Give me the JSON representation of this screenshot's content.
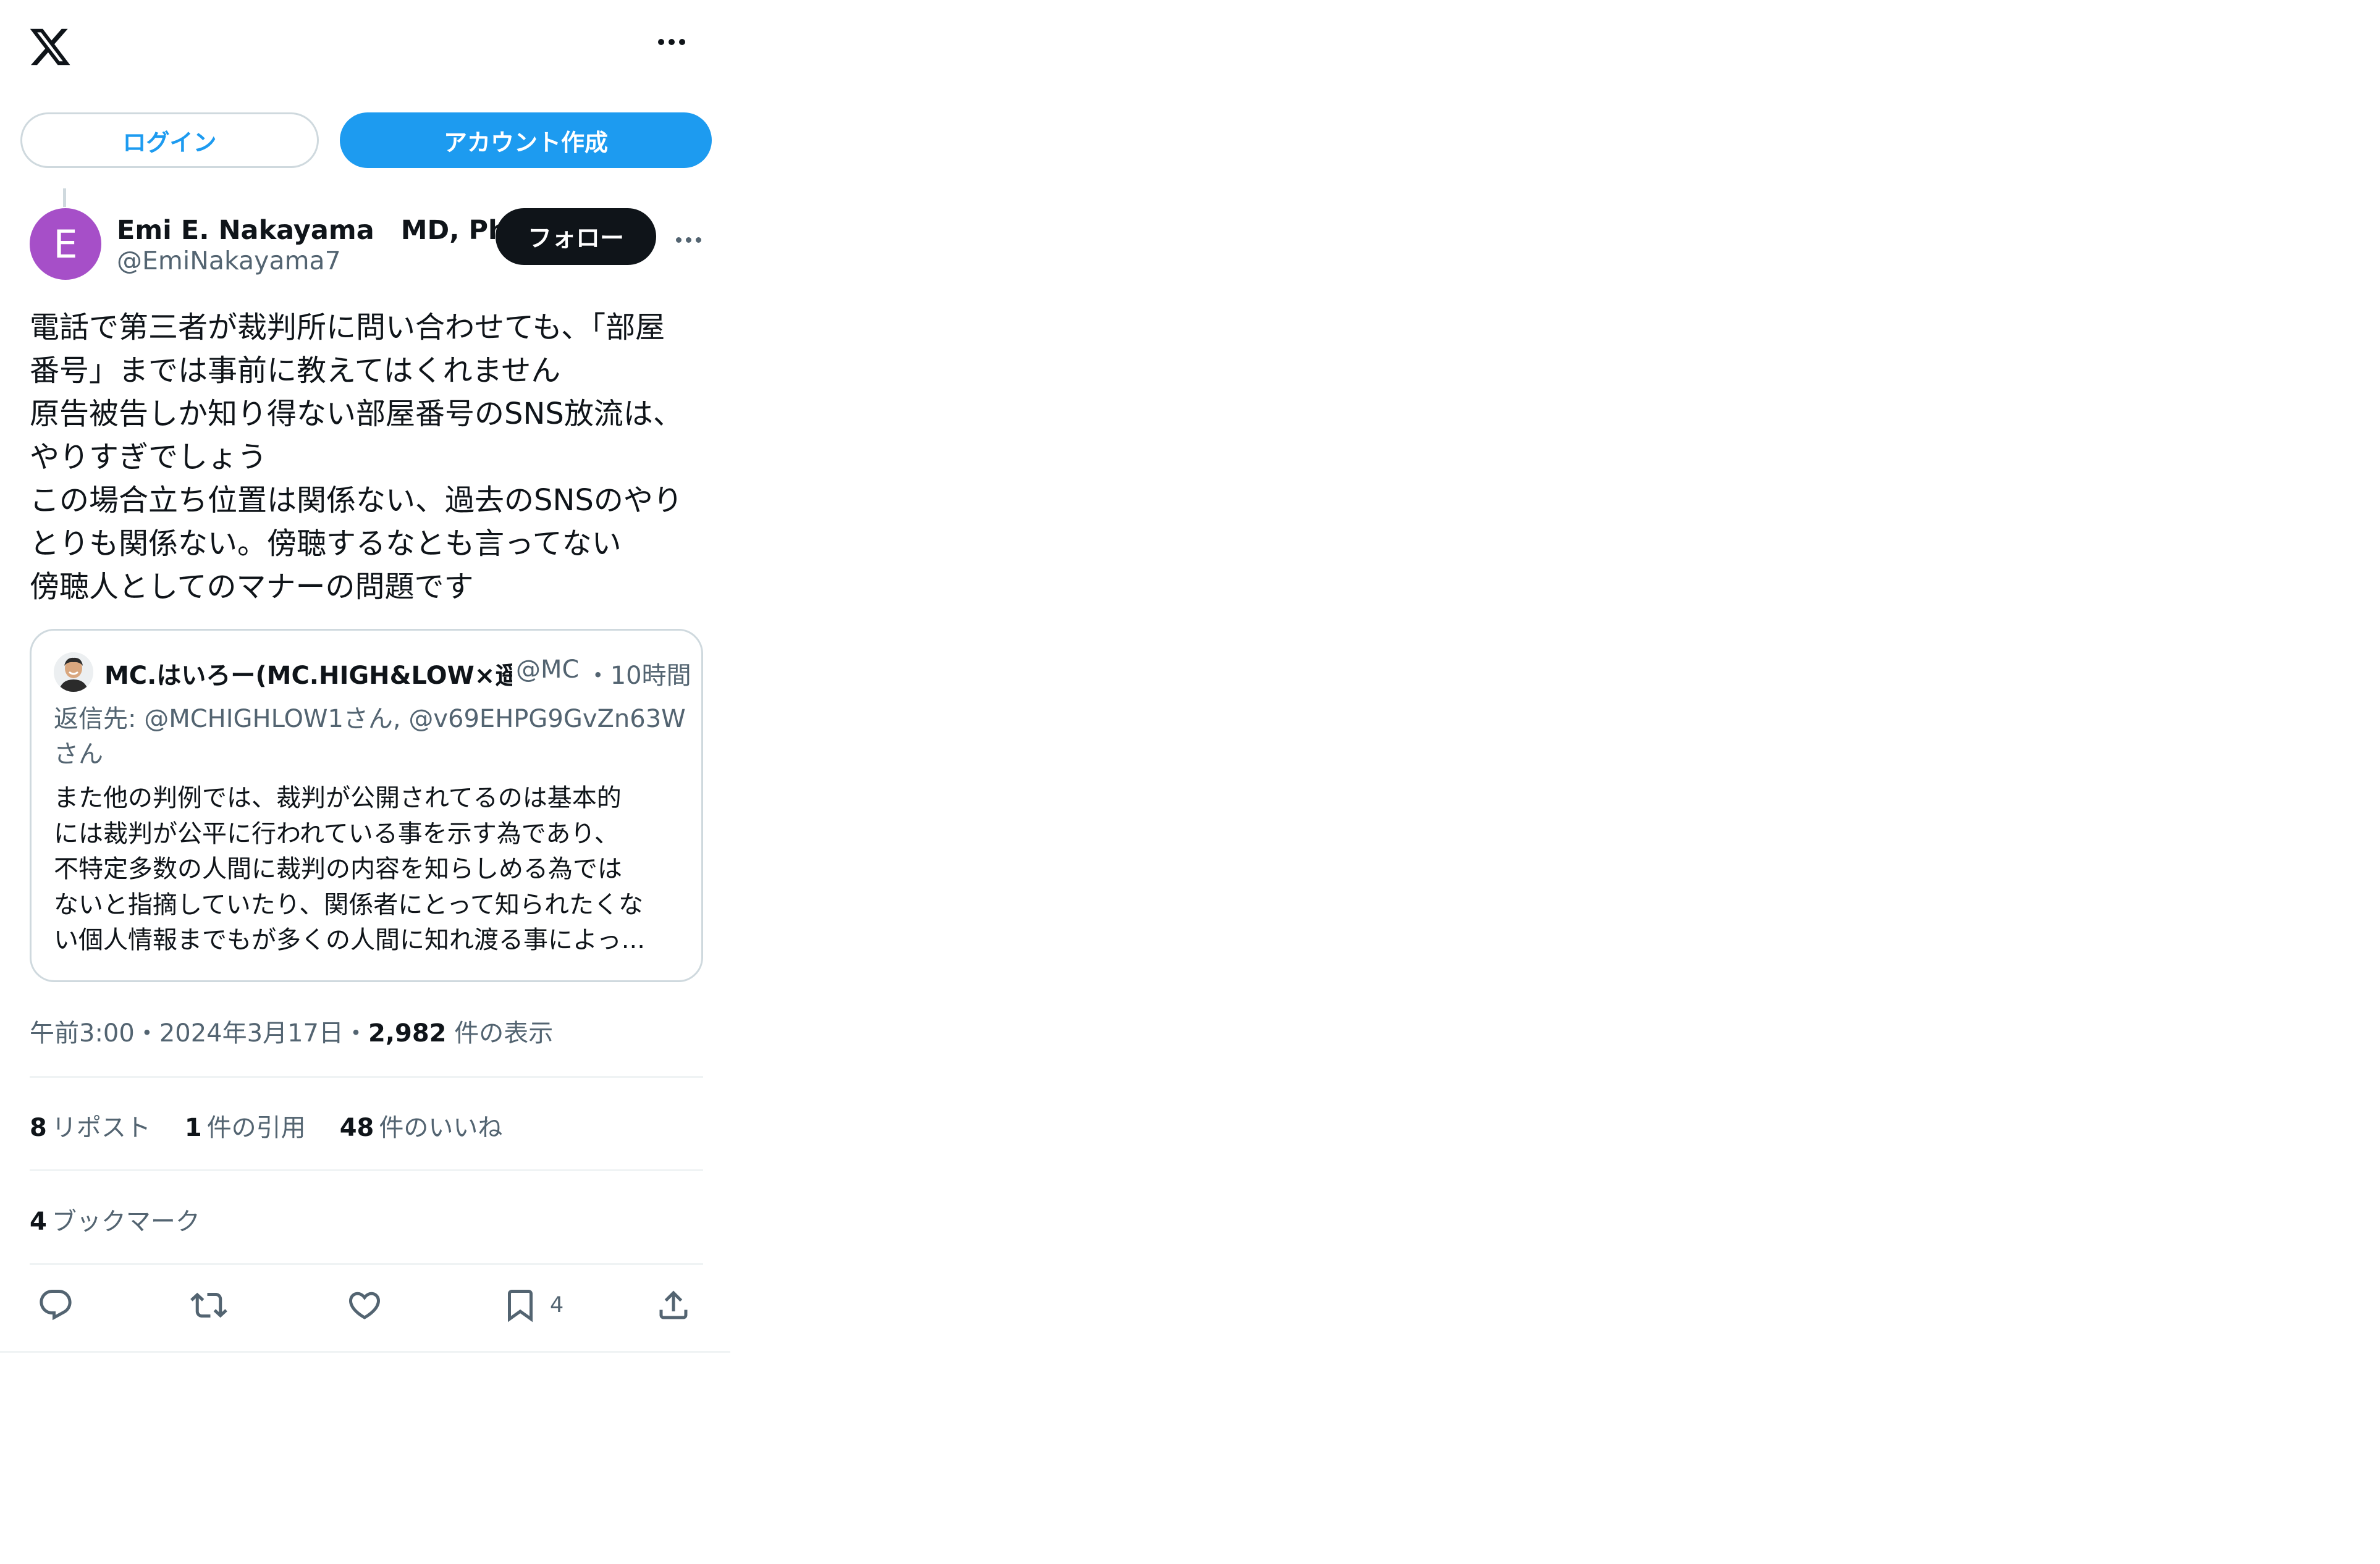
{
  "header": {
    "logo": "x-logo",
    "more_icon": "more-horizontal-icon",
    "login_label": "ログイン",
    "signup_label": "アカウント作成"
  },
  "tweet": {
    "avatar_letter": "E",
    "avatar_color": "#a64fc8",
    "author_name": "Emi E. Nakayama　MD, PhD",
    "handle": "@EmiNakayama7",
    "follow_label": "フォロー",
    "text_lines": [
      "電話で第三者が裁判所に問い合わせても、「部屋",
      "番号」までは事前に教えてはくれません",
      "原告被告しか知り得ない部屋番号のSNS放流は、",
      "やりすぎでしょう",
      "この場合立ち位置は関係ない、過去のSNSのやり",
      "とりも関係ない。傍聴するなとも言ってない",
      "傍聴人としてのマナーの問題です"
    ]
  },
  "quote": {
    "name": "MC.はいろー(MC.HIGH&LOW×遥",
    "handle": "@MC",
    "separator": "・",
    "time": "10時間",
    "reply_to": "返信先: @MCHIGHLOW1さん, @v69EHPG9GvZn63Wさん",
    "body_lines": [
      "また他の判例では、裁判が公開されてるのは基本的",
      "には裁判が公平に行われている事を示す為であり、",
      "不特定多数の人間に裁判の内容を知らしめる為では",
      "ないと指摘していたり、関係者にとって知られたくな",
      "い個人情報までもが多くの人間に知れ渡る事によっ..."
    ]
  },
  "meta": {
    "time": "午前3:00",
    "sep1": "・",
    "date": "2024年3月17日",
    "sep2": "・",
    "views": "2,982",
    "views_label": " 件の表示"
  },
  "stats": {
    "reposts": "8",
    "reposts_label": "リポスト",
    "quotes": "1",
    "quotes_label": "件の引用",
    "likes": "48",
    "likes_label": "件のいいね",
    "bookmarks": "4",
    "bookmarks_label": "ブックマーク"
  },
  "actions": {
    "reply_icon": "reply-icon",
    "repost_icon": "repost-icon",
    "like_icon": "heart-icon",
    "bookmark_icon": "bookmark-icon",
    "bookmark_count": "4",
    "share_icon": "share-icon"
  },
  "colors": {
    "accent": "#1d9bf0",
    "text": "#0f1419",
    "secondary": "#536471",
    "border": "#cfd9de"
  }
}
